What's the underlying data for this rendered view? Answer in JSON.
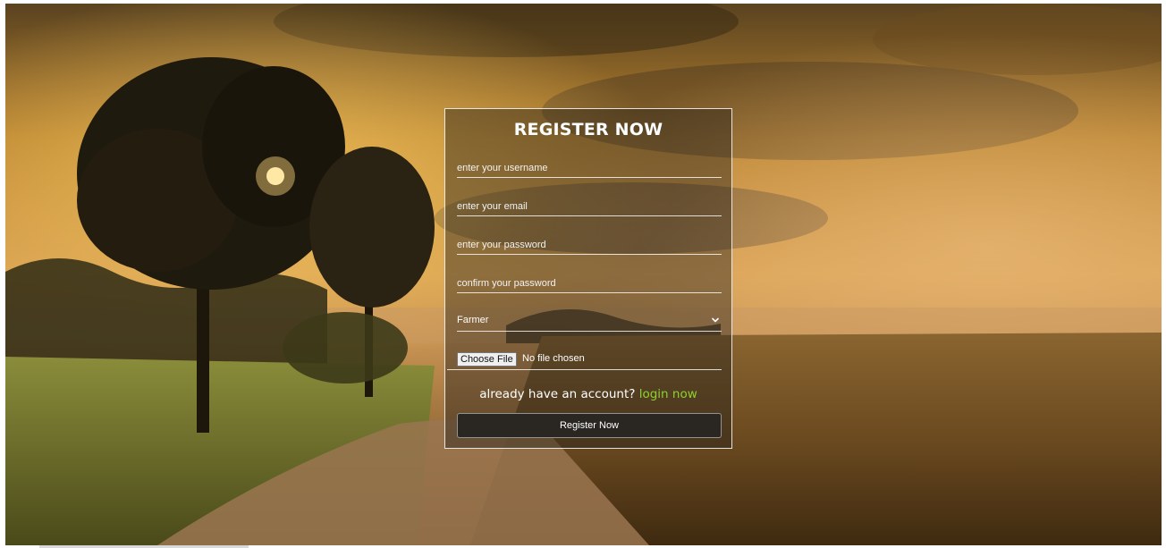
{
  "form": {
    "title": "REGISTER NOW",
    "username_placeholder": "enter your username",
    "email_placeholder": "enter your email",
    "password_placeholder": "enter your password",
    "confirm_placeholder": "confirm your password",
    "user_type_selected": "Farmer",
    "file_button_label": "Choose File",
    "file_status": "No file chosen",
    "login_prompt": "already have an account?",
    "login_link": "login now",
    "submit_label": "Register Now"
  },
  "colors": {
    "accent_link": "#8ed12e",
    "panel_bg": "rgba(30,28,26,0.42)",
    "button_bg": "#2a2622"
  },
  "icons": {
    "select_chevron": "chevron-down-icon"
  }
}
